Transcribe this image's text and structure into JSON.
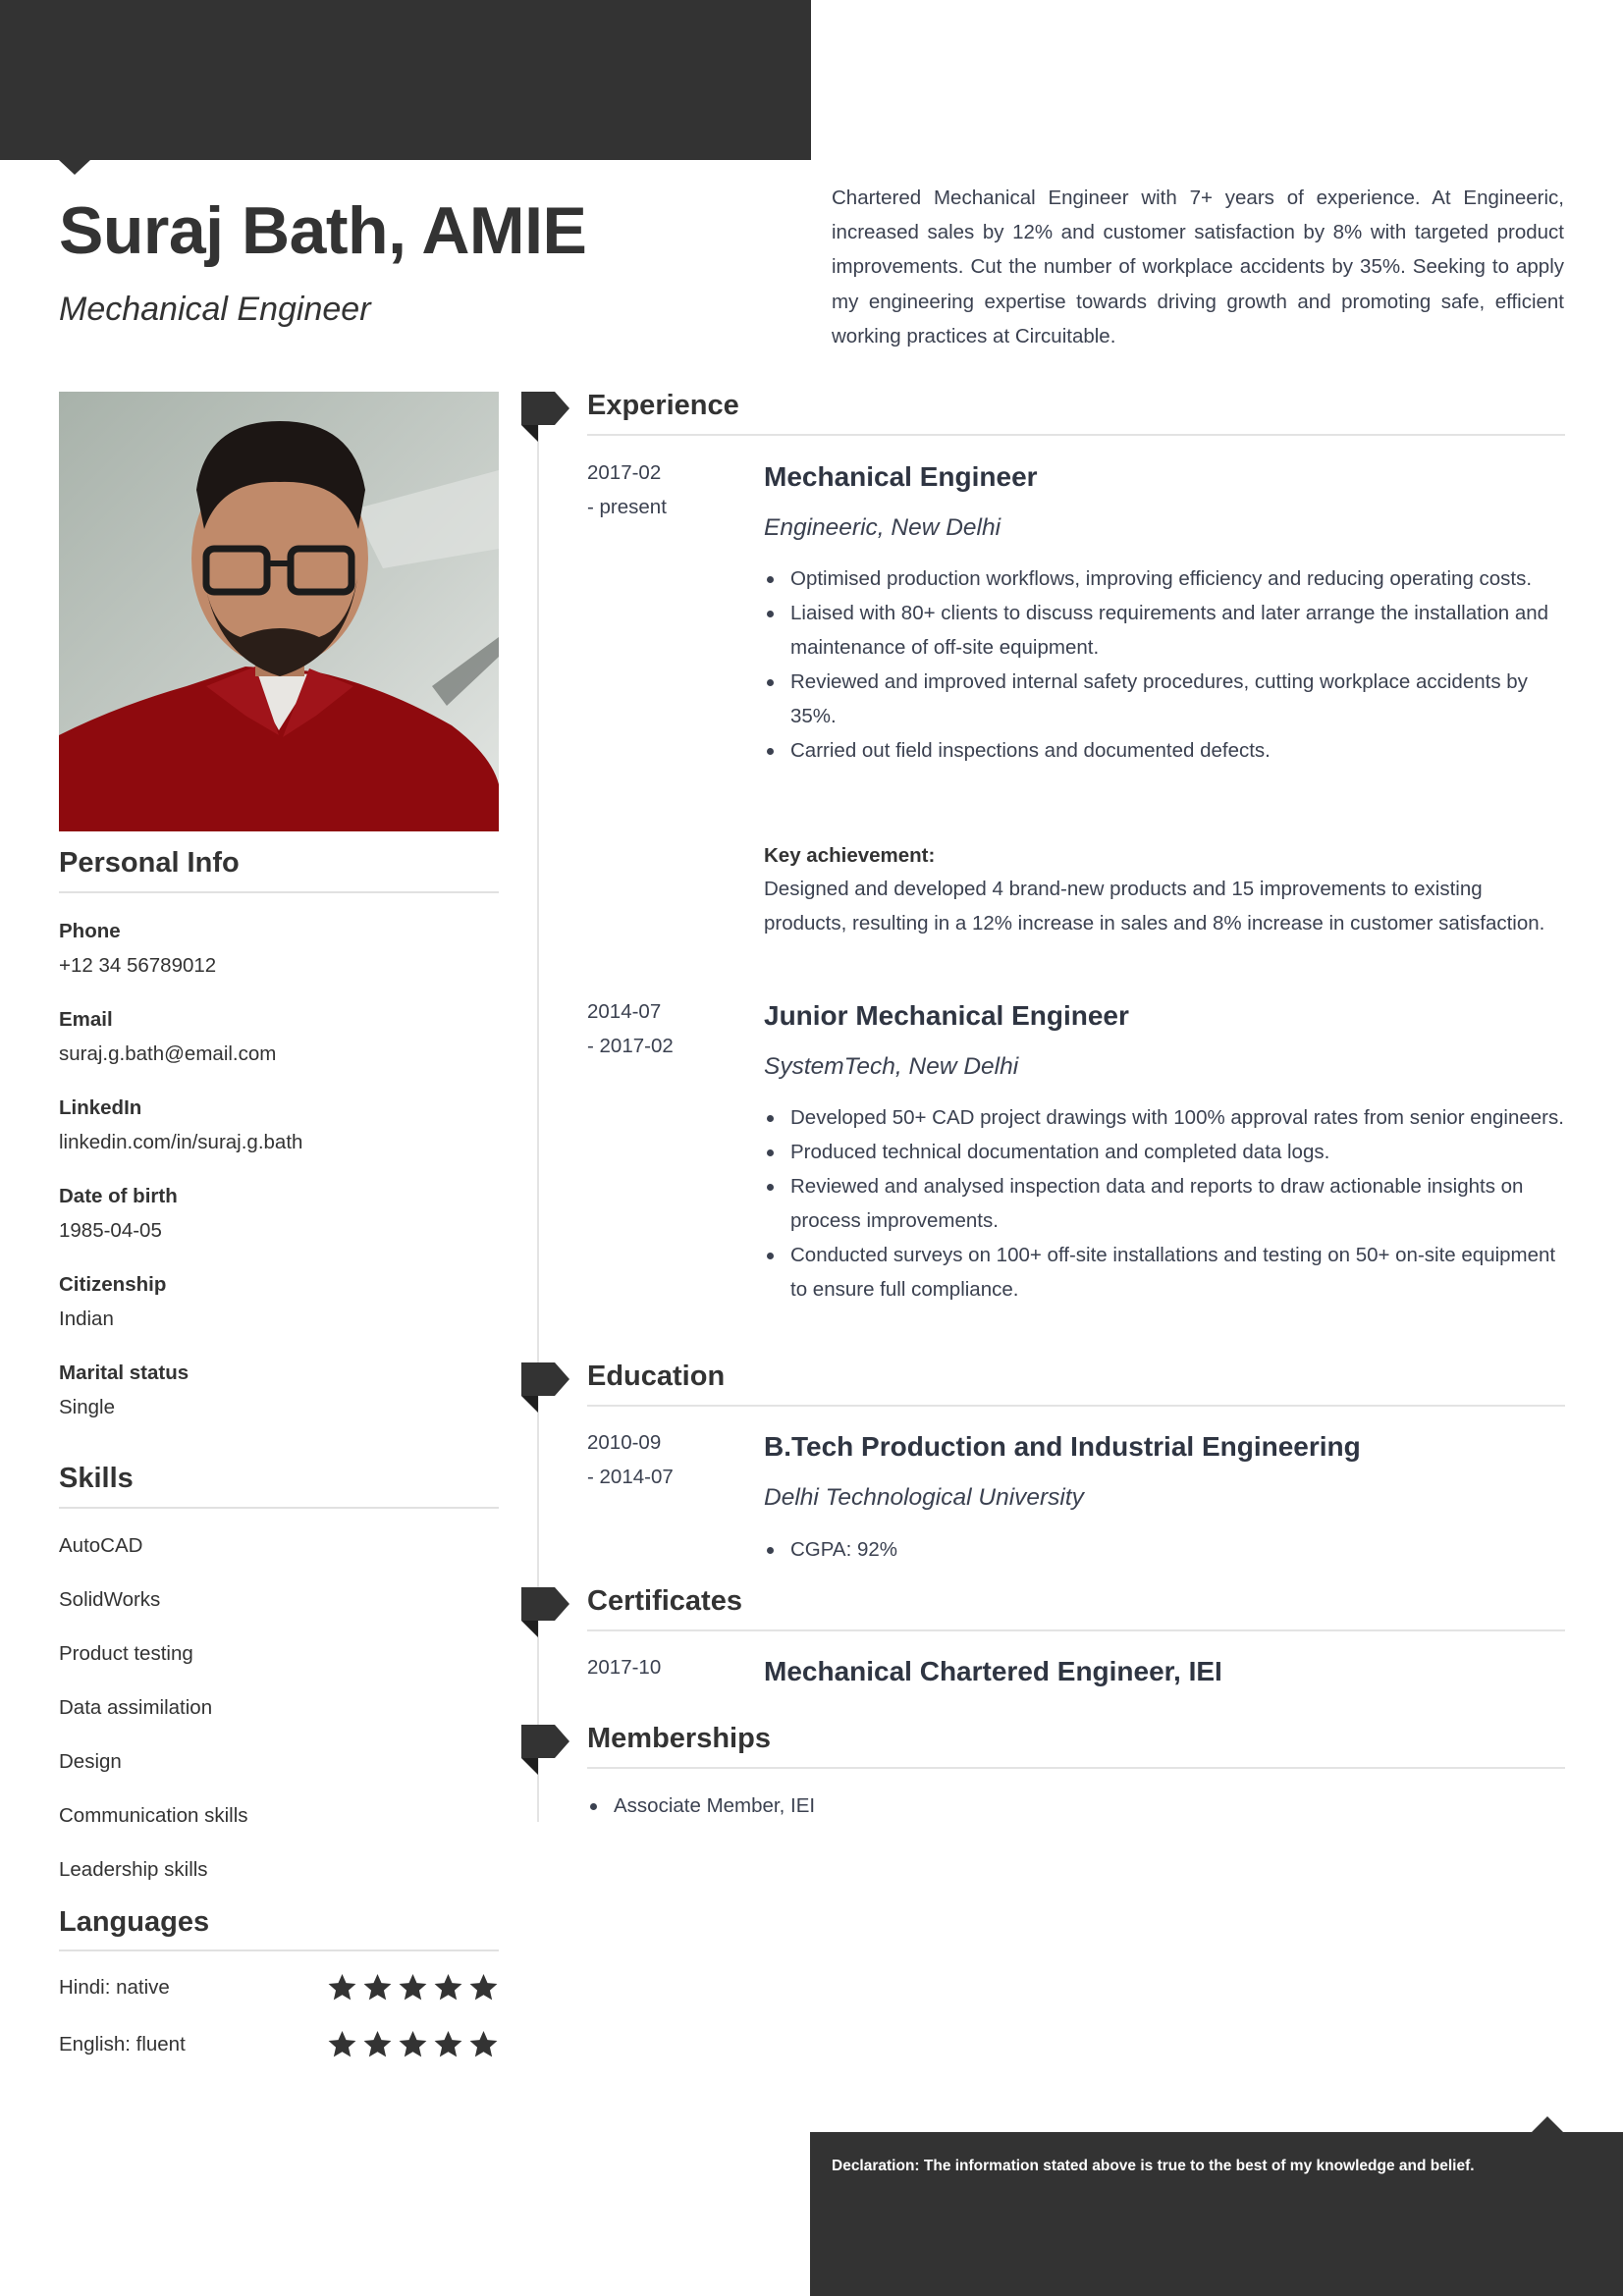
{
  "header": {
    "name": "Suraj Bath, AMIE",
    "title": "Mechanical Engineer",
    "summary": "Chartered Mechanical Engineer with 7+ years of experience. At Engineeric, increased sales by 12% and customer satisfaction by 8% with targeted product improvements. Cut the number of workplace accidents by 35%. Seeking to apply my engineering expertise towards driving growth and promoting safe, efficient working practices at Circuitable."
  },
  "colors": {
    "dark": "#333333",
    "text": "#3b4150",
    "rule": "#e1e1e1"
  },
  "sidebar": {
    "photo_alt": "profile-photo",
    "personal_info": {
      "heading": "Personal Info",
      "fields": [
        {
          "label": "Phone",
          "value": "+12 34 56789012"
        },
        {
          "label": "Email",
          "value": "suraj.g.bath@email.com"
        },
        {
          "label": "LinkedIn",
          "value": "linkedin.com/in/suraj.g.bath"
        },
        {
          "label": "Date of birth",
          "value": "1985-04-05"
        },
        {
          "label": "Citizenship",
          "value": "Indian"
        },
        {
          "label": "Marital status",
          "value": "Single"
        }
      ]
    },
    "skills": {
      "heading": "Skills",
      "items": [
        "AutoCAD",
        "SolidWorks",
        "Product testing",
        "Data assimilation",
        "Design",
        "Communication skills",
        "Leadership skills"
      ]
    },
    "languages": {
      "heading": "Languages",
      "items": [
        {
          "label": "Hindi: native",
          "rating": 5,
          "max": 5
        },
        {
          "label": "English: fluent",
          "rating": 5,
          "max": 5
        }
      ]
    }
  },
  "experience": {
    "heading": "Experience",
    "entries": [
      {
        "date_start": "2017-02",
        "date_end": "- present",
        "title": "Mechanical Engineer",
        "company": "Engineeric, New Delhi",
        "bullets": [
          "Optimised production workflows, improving efficiency and reducing operating costs.",
          "Liaised with 80+ clients to discuss requirements and later arrange the installation and maintenance of off-site equipment.",
          "Reviewed and improved internal safety procedures, cutting workplace accidents by 35%.",
          "Carried out field inspections and documented defects."
        ],
        "key_achievement_label": "Key achievement:",
        "key_achievement": "Designed and developed 4 brand-new products and 15 improvements to existing products, resulting in a 12% increase in sales and 8% increase in customer satisfaction."
      },
      {
        "date_start": "2014-07",
        "date_end": "- 2017-02",
        "title": "Junior Mechanical Engineer",
        "company": "SystemTech, New Delhi",
        "bullets": [
          "Developed 50+ CAD project drawings with 100% approval rates from senior engineers.",
          "Produced technical documentation and completed data logs.",
          "Reviewed and analysed inspection data and reports to draw actionable insights on process improvements.",
          "Conducted surveys on 100+ off-site installations and testing on 50+ on-site equipment to ensure full compliance."
        ]
      }
    ]
  },
  "education": {
    "heading": "Education",
    "entries": [
      {
        "date_start": "2010-09",
        "date_end": "- 2014-07",
        "title": "B.Tech Production and Industrial Engineering",
        "school": "Delhi Technological University",
        "bullets": [
          "CGPA: 92%"
        ]
      }
    ]
  },
  "certificates": {
    "heading": "Certificates",
    "entries": [
      {
        "date": "2017-10",
        "title": "Mechanical Chartered Engineer, IEI"
      }
    ]
  },
  "memberships": {
    "heading": "Memberships",
    "items": [
      "Associate Member, IEI"
    ]
  },
  "footer": {
    "declaration": "Declaration: The information stated above is true to the best of my knowledge and belief."
  }
}
